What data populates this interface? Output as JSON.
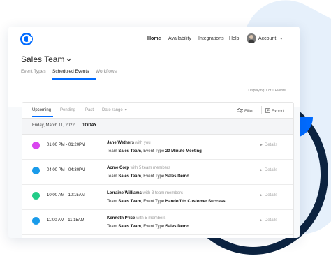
{
  "nav": {
    "items": [
      {
        "label": "Home",
        "active": true
      },
      {
        "label": "Availability",
        "active": false
      },
      {
        "label": "Integrations",
        "active": false
      },
      {
        "label": "Help",
        "active": false
      }
    ],
    "account_label": "Account"
  },
  "team": {
    "title": "Sales Team",
    "tabs": [
      {
        "label": "Event Types",
        "active": false
      },
      {
        "label": "Scheduled Events",
        "active": true
      },
      {
        "label": "Workflows",
        "active": false
      }
    ],
    "displaying": "Displaying 1 of 1 Events"
  },
  "panel": {
    "tabs": [
      {
        "label": "Upcoming",
        "active": true
      },
      {
        "label": "Pending",
        "active": false
      },
      {
        "label": "Past",
        "active": false
      },
      {
        "label": "Date range",
        "active": false
      }
    ],
    "filter_label": "Filter",
    "export_label": "Export",
    "date": "Friday, March 11, 2022",
    "today": "TODAY",
    "events": [
      {
        "color": "#d946ef",
        "time": "01:00 PM - 01:20PM",
        "name": "Jane Wethers",
        "with": "with you",
        "team_prefix": "Team ",
        "team": "Sales Team",
        "type_prefix": ", Event Type ",
        "type": "20 Minute Meeting",
        "details": "Details"
      },
      {
        "color": "#1a9bea",
        "time": "04:00 PM - 04:30PM",
        "name": "Acme Corp",
        "with": "with 5 team members",
        "team_prefix": "Team ",
        "team": "Sales Team",
        "type_prefix": ", Event Type ",
        "type": "Sales Demo",
        "details": "Details"
      },
      {
        "color": "#22cc88",
        "time": "10:00 AM - 10:15AM",
        "name": "Lorraine Williams",
        "with": "with 3 team members",
        "team_prefix": "Team ",
        "team": "Sales Team",
        "type_prefix": ", Event Type ",
        "type": "Handoff to Customer Success",
        "details": "Details"
      },
      {
        "color": "#1a9bea",
        "time": "11:00 AM - 11:15AM",
        "name": "Kenneth Price",
        "with": "with 5 members",
        "team_prefix": "Team ",
        "team": "Sales Team",
        "type_prefix": ", Event Type ",
        "type": "Sales Demo",
        "details": "Details"
      }
    ]
  },
  "colors": {
    "accent": "#006bff",
    "navy": "#0c2340",
    "light_blue_bg": "#e6f0fb"
  }
}
